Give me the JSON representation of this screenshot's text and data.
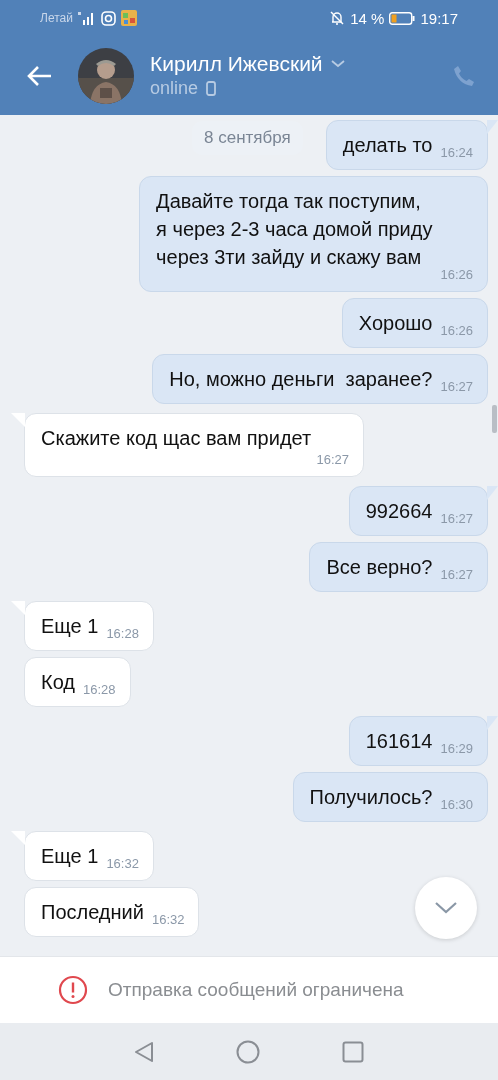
{
  "status_bar": {
    "carrier": "Летай",
    "battery": "14 %",
    "time": "19:17"
  },
  "header": {
    "name": "Кирилл Ижевский",
    "status": "online"
  },
  "date_badge": "8 сентября",
  "messages": [
    {
      "kind": "out",
      "lines": [
        "делать то"
      ],
      "time": "16:24"
    },
    {
      "kind": "out",
      "lines": [
        "Давайте тогда так поступим,",
        "я через 2-3 часа домой приду",
        "через 3ти зайду и скажу вам"
      ],
      "time": "16:26"
    },
    {
      "kind": "out",
      "lines": [
        "Хорошо"
      ],
      "time": "16:26"
    },
    {
      "kind": "out",
      "lines": [
        "Но, можно деньги  заранее?"
      ],
      "time": "16:27"
    },
    {
      "kind": "in",
      "lines": [
        "Скажите код щас вам придет"
      ],
      "time": "16:27"
    },
    {
      "kind": "out",
      "lines": [
        "992664"
      ],
      "time": "16:27"
    },
    {
      "kind": "out",
      "lines": [
        "Все верно?"
      ],
      "time": "16:27"
    },
    {
      "kind": "in",
      "lines": [
        "Еще 1"
      ],
      "time": "16:28"
    },
    {
      "kind": "in",
      "lines": [
        "Код"
      ],
      "time": "16:28"
    },
    {
      "kind": "out",
      "lines": [
        "161614"
      ],
      "time": "16:29"
    },
    {
      "kind": "out",
      "lines": [
        "Получилось?"
      ],
      "time": "16:30"
    },
    {
      "kind": "in",
      "lines": [
        "Еще 1"
      ],
      "time": "16:32"
    },
    {
      "kind": "in",
      "lines": [
        "Последний"
      ],
      "time": "16:32"
    }
  ],
  "notice": "Отправка сообщений ограничена"
}
